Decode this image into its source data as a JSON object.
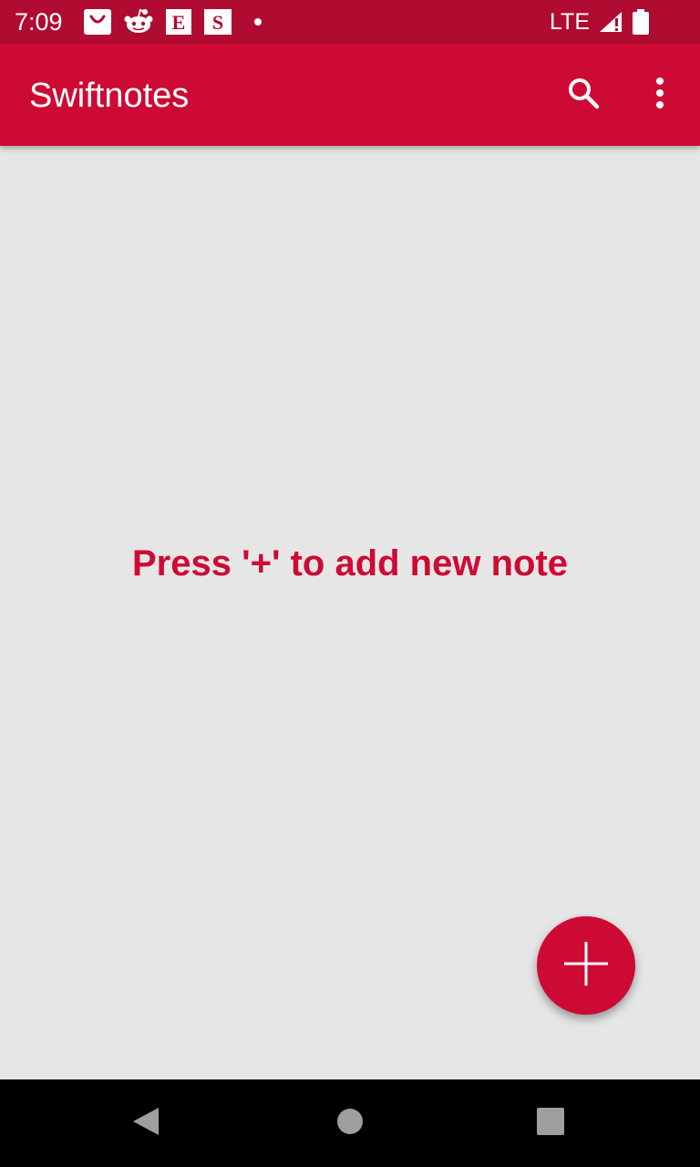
{
  "status_bar": {
    "time": "7:09",
    "network": "LTE",
    "notification_icons": [
      "shopping-bag-icon",
      "reddit-icon",
      "etsy-icon",
      "square-s-icon",
      "more-notifications-dot-icon"
    ],
    "system_icons": [
      "signal-icon",
      "battery-icon"
    ]
  },
  "app_bar": {
    "title": "Swiftnotes",
    "actions": [
      "search-icon",
      "overflow-menu-icon"
    ]
  },
  "main": {
    "empty_message": "Press '+' to add new note"
  },
  "fab": {
    "icon": "plus-icon"
  },
  "nav_bar": {
    "buttons": [
      "back-icon",
      "home-icon",
      "recents-icon"
    ]
  },
  "colors": {
    "status_bar": "#b00b30",
    "primary": "#cd0a34",
    "background": "#e6e6e6",
    "nav_bar": "#000000",
    "nav_icons": "#9e9e9e"
  }
}
